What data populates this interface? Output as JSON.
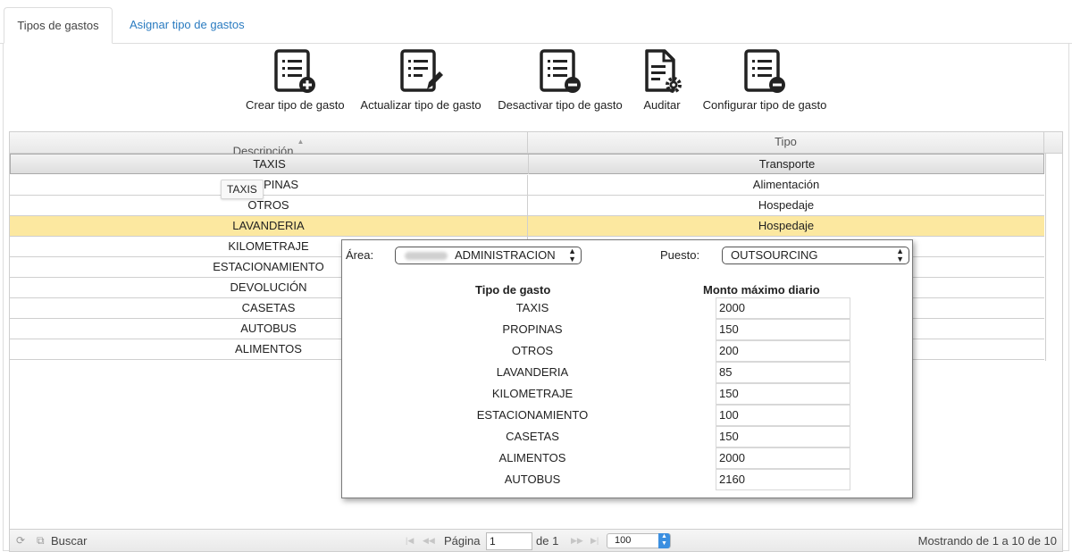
{
  "tabs": [
    {
      "label": "Tipos de gastos",
      "active": true
    },
    {
      "label": "Asignar tipo de gastos",
      "active": false
    }
  ],
  "toolbar": [
    {
      "label": "Crear tipo de gasto",
      "icon": "document-add-icon"
    },
    {
      "label": "Actualizar tipo de gasto",
      "icon": "document-edit-icon"
    },
    {
      "label": "Desactivar tipo de gasto",
      "icon": "document-remove-icon"
    },
    {
      "label": "Auditar",
      "icon": "document-gear-icon"
    },
    {
      "label": "Configurar tipo de gasto",
      "icon": "document-remove-icon"
    }
  ],
  "grid": {
    "headers": [
      "Descripción",
      "Tipo"
    ],
    "rows": [
      {
        "descripcion": "TAXIS",
        "tipo": "Transporte",
        "state": "selected"
      },
      {
        "descripcion": "PROPINAS",
        "tipo": "Alimentación",
        "state": ""
      },
      {
        "descripcion": "OTROS",
        "tipo": "Hospedaje",
        "state": ""
      },
      {
        "descripcion": "LAVANDERIA",
        "tipo": "Hospedaje",
        "state": "hover"
      },
      {
        "descripcion": "KILOMETRAJE",
        "tipo": "",
        "state": ""
      },
      {
        "descripcion": "ESTACIONAMIENTO",
        "tipo": "",
        "state": ""
      },
      {
        "descripcion": "DEVOLUCIÓN",
        "tipo": "",
        "state": ""
      },
      {
        "descripcion": "CASETAS",
        "tipo": "",
        "state": ""
      },
      {
        "descripcion": "AUTOBUS",
        "tipo": "",
        "state": ""
      },
      {
        "descripcion": "ALIMENTOS",
        "tipo": "",
        "state": ""
      }
    ],
    "tooltip": "TAXIS"
  },
  "pager": {
    "search_label": "Buscar",
    "page_label": "Página",
    "page_value": "1",
    "of_label": "de 1",
    "rows_per_page": "100",
    "status": "Mostrando de 1 a 10 de 10"
  },
  "popup": {
    "area_label": "Área:",
    "area_value": "ADMINISTRACION",
    "puesto_label": "Puesto:",
    "puesto_value": "OUTSOURCING",
    "col_tipo": "Tipo de gasto",
    "col_monto": "Monto máximo diario",
    "rows": [
      {
        "tipo": "TAXIS",
        "monto": "2000"
      },
      {
        "tipo": "PROPINAS",
        "monto": "150"
      },
      {
        "tipo": "OTROS",
        "monto": "200"
      },
      {
        "tipo": "LAVANDERIA",
        "monto": "85"
      },
      {
        "tipo": "KILOMETRAJE",
        "monto": "150"
      },
      {
        "tipo": "ESTACIONAMIENTO",
        "monto": "100"
      },
      {
        "tipo": "CASETAS",
        "monto": "150"
      },
      {
        "tipo": "ALIMENTOS",
        "monto": "2000"
      },
      {
        "tipo": "AUTOBUS",
        "monto": "2160"
      }
    ]
  },
  "colors": {
    "link": "#2a7bc0",
    "hover_row": "#fce8a0",
    "select_arrow": "#3b8fe0"
  }
}
